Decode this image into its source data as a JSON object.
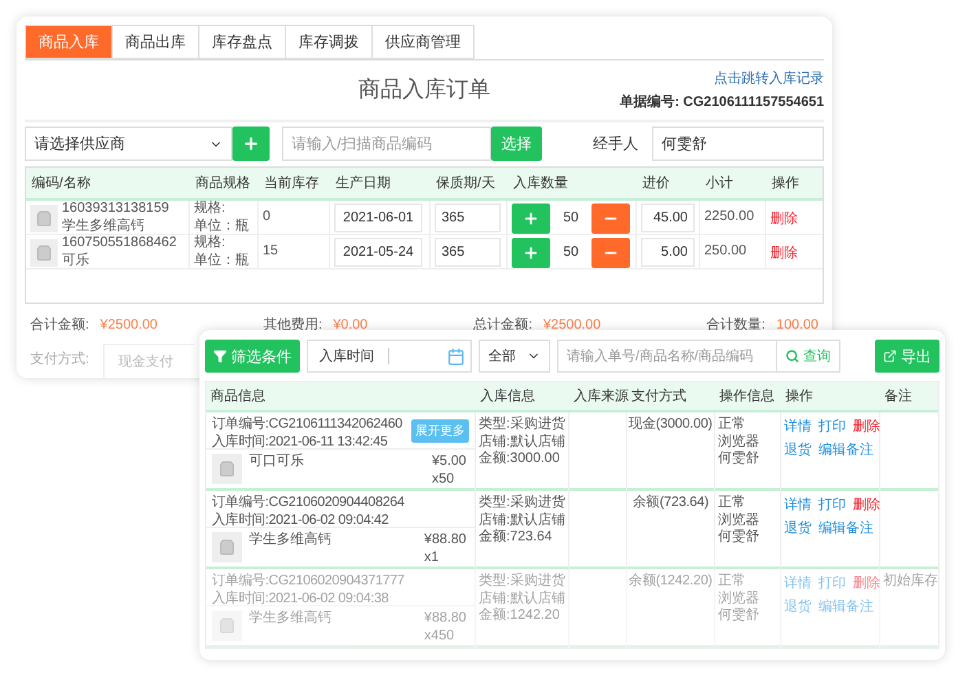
{
  "tabs": [
    {
      "label": "商品入库",
      "selected": true
    },
    {
      "label": "商品出库",
      "selected": false
    },
    {
      "label": "库存盘点",
      "selected": false
    },
    {
      "label": "库存调拨",
      "selected": false
    },
    {
      "label": "供应商管理",
      "selected": false
    }
  ],
  "order_form": {
    "title": "商品入库订单",
    "record_link": "点击跳转入库记录",
    "doc_number": "单据编号: CG2106111157554651",
    "supplier_select": "请选择供应商",
    "barcode_placeholder": "请输入/扫描商品编码",
    "select_button": "选择",
    "handler_label": "经手人",
    "handler_value": "何雯舒"
  },
  "items_table": {
    "columns": [
      "编码/名称",
      "商品规格",
      "当前库存",
      "生产日期",
      "保质期/天",
      "入库数量",
      "进价",
      "小计",
      "操作"
    ],
    "rows": [
      {
        "code": "16039313138159",
        "name": "学生多维高钙",
        "spec": "规格:",
        "unit": "单位：瓶",
        "stock": "0",
        "production_date": "2021-06-01",
        "shelf_life": "365",
        "quantity": "50",
        "price": "45.00",
        "subtotal": "2250.00",
        "action": "删除"
      },
      {
        "code": "160750551868462",
        "name": "可乐",
        "spec": "规格:",
        "unit": "单位：瓶",
        "stock": "15",
        "production_date": "2021-05-24",
        "shelf_life": "365",
        "quantity": "50",
        "price": "5.00",
        "subtotal": "250.00",
        "action": "删除"
      }
    ]
  },
  "totals": [
    {
      "label": "合计金额:",
      "value": "¥2500.00"
    },
    {
      "label": "其他费用:",
      "value": "¥0.00"
    },
    {
      "label": "总计金额:",
      "value": "¥2500.00"
    },
    {
      "label": "合计数量:",
      "value": "100.00"
    }
  ],
  "payment": {
    "label": "支付方式:",
    "value": "现金支付"
  },
  "records": {
    "filter_button": "筛选条件",
    "date_label": "入库时间",
    "status_select": "全部",
    "search_placeholder": "请输入单号/商品名称/商品编码",
    "search_button": "查询",
    "export_button": "导出",
    "columns": [
      "商品信息",
      "入库信息",
      "入库来源",
      "支付方式",
      "操作信息",
      "操作",
      "备注"
    ],
    "orders": [
      {
        "order_no": "订单编号:CG2106111342062460",
        "time": "入库时间:2021-06-11 13:42:45",
        "badge": "展开更多",
        "type": "类型:采购进货",
        "store": "店铺:默认店铺",
        "amount": "金额:3000.00",
        "payment": "现金(3000.00)",
        "status": "正常",
        "browser": "浏览器",
        "operator": "何雯舒",
        "actions": [
          {
            "label": "详情",
            "kind": "link"
          },
          {
            "label": "打印",
            "kind": "link"
          },
          {
            "label": "删除",
            "kind": "danger"
          },
          {
            "label": "退货",
            "kind": "link"
          },
          {
            "label": "编辑备注",
            "kind": "link"
          }
        ],
        "product": {
          "name": "可口可乐",
          "price": "¥5.00",
          "qty": "x50"
        },
        "faded": false
      },
      {
        "order_no": "订单编号:CG2106020904408264",
        "time": "入库时间:2021-06-02 09:04:42",
        "type": "类型:采购进货",
        "store": "店铺:默认店铺",
        "amount": "金额:723.64",
        "payment": "余额(723.64)",
        "status": "正常",
        "browser": "浏览器",
        "operator": "何雯舒",
        "actions": [
          {
            "label": "详情",
            "kind": "link"
          },
          {
            "label": "打印",
            "kind": "link"
          },
          {
            "label": "删除",
            "kind": "danger"
          },
          {
            "label": "退货",
            "kind": "link"
          },
          {
            "label": "编辑备注",
            "kind": "link"
          }
        ],
        "product": {
          "name": "学生多维高钙",
          "price": "¥88.80",
          "qty": "x1"
        },
        "faded": false
      },
      {
        "order_no": "订单编号:CG2106020904371777",
        "time": "入库时间:2021-06-02 09:04:38",
        "type": "类型:采购进货",
        "store": "店铺:默认店铺",
        "amount": "金额:1242.20",
        "payment": "余额(1242.20)",
        "status": "正常",
        "browser": "浏览器",
        "operator": "何雯舒",
        "actions": [
          {
            "label": "详情",
            "kind": "link"
          },
          {
            "label": "打印",
            "kind": "link"
          },
          {
            "label": "删除",
            "kind": "danger"
          },
          {
            "label": "退货",
            "kind": "link"
          },
          {
            "label": "编辑备注",
            "kind": "link"
          }
        ],
        "note": "初始库存",
        "product": {
          "name": "学生多维高钙",
          "price": "¥88.80",
          "qty": "x450"
        },
        "faded": true
      }
    ]
  }
}
